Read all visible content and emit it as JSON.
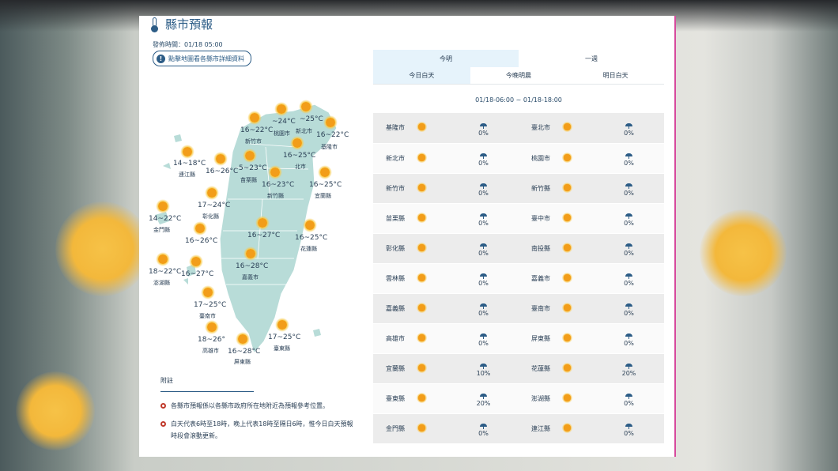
{
  "section": {
    "title": "縣市預報",
    "icon": "thermometer-icon",
    "issued": "發佈時間：01/18 05:00",
    "detail_button": "點擊地圖看各縣市詳細資料"
  },
  "map": {
    "labels": [
      {
        "temp": "16~22°C",
        "name": "新竹市"
      },
      {
        "temp": "~24°C",
        "name": "桃園市"
      },
      {
        "temp": "~25°C",
        "name": "新北市"
      },
      {
        "temp": "16~22°C",
        "name": "基隆市"
      },
      {
        "temp": "16~25°C",
        "name": "北市"
      },
      {
        "temp": "14~18°C",
        "name": "連江縣"
      },
      {
        "temp": "16~26°C",
        "name": ""
      },
      {
        "temp": "5~23°C",
        "name": "苗栗縣"
      },
      {
        "temp": "16~23°C",
        "name": "新竹縣"
      },
      {
        "temp": "16~25°C",
        "name": "宜蘭縣"
      },
      {
        "temp": "17~24°C",
        "name": "彰化縣"
      },
      {
        "temp": "14~22°C",
        "name": "金門縣"
      },
      {
        "temp": "16~27°C",
        "name": ""
      },
      {
        "temp": "16~26°C",
        "name": ""
      },
      {
        "temp": "16~25°C",
        "name": "花蓮縣"
      },
      {
        "temp": "16~28°C",
        "name": "嘉義市"
      },
      {
        "temp": "18~22°C",
        "name": "澎湖縣"
      },
      {
        "temp": "16~27°C",
        "name": ""
      },
      {
        "temp": "17~25°C",
        "name": "臺南市"
      },
      {
        "temp": "17~25°C",
        "name": "臺東縣"
      },
      {
        "temp": "18~26°",
        "name": "高雄市"
      },
      {
        "temp": "16~28°C",
        "name": "屏東縣"
      }
    ]
  },
  "notes": {
    "title": "附註",
    "items": [
      "各縣市預報係以各縣市政府所在地附近為預報參考位置。",
      "白天代表6時至18時，晚上代表18時至隔日6時，惟今日白天預報時段會滾動更新。"
    ]
  },
  "tabs": [
    {
      "label": "今明",
      "active": true
    },
    {
      "label": "一週",
      "active": false
    }
  ],
  "subtabs": [
    {
      "label": "今日白天",
      "active": true
    },
    {
      "label": "今晚明晨",
      "active": false
    },
    {
      "label": "明日白天",
      "active": false
    }
  ],
  "period": "01/18-06:00 ~ 01/18-18:00",
  "rows": [
    [
      {
        "city": "基隆市",
        "rain": "0%"
      },
      {
        "city": "臺北市",
        "rain": "0%"
      }
    ],
    [
      {
        "city": "新北市",
        "rain": "0%"
      },
      {
        "city": "桃園市",
        "rain": "0%"
      }
    ],
    [
      {
        "city": "新竹市",
        "rain": "0%"
      },
      {
        "city": "新竹縣",
        "rain": "0%"
      }
    ],
    [
      {
        "city": "苗栗縣",
        "rain": "0%"
      },
      {
        "city": "臺中市",
        "rain": "0%"
      }
    ],
    [
      {
        "city": "彰化縣",
        "rain": "0%"
      },
      {
        "city": "南投縣",
        "rain": "0%"
      }
    ],
    [
      {
        "city": "雲林縣",
        "rain": "0%"
      },
      {
        "city": "嘉義市",
        "rain": "0%"
      }
    ],
    [
      {
        "city": "嘉義縣",
        "rain": "0%"
      },
      {
        "city": "臺南市",
        "rain": "0%"
      }
    ],
    [
      {
        "city": "高雄市",
        "rain": "0%"
      },
      {
        "city": "屏東縣",
        "rain": "0%"
      }
    ],
    [
      {
        "city": "宜蘭縣",
        "rain": "10%"
      },
      {
        "city": "花蓮縣",
        "rain": "20%"
      }
    ],
    [
      {
        "city": "臺東縣",
        "rain": "20%"
      },
      {
        "city": "澎湖縣",
        "rain": "0%"
      }
    ],
    [
      {
        "city": "金門縣",
        "rain": "0%"
      },
      {
        "city": "連江縣",
        "rain": "0%"
      }
    ]
  ],
  "colors": {
    "accent": "#2c5c86",
    "map_land": "#b8dcd8",
    "tab_active": "#e6f3fb",
    "sun": "#f29d1a"
  }
}
